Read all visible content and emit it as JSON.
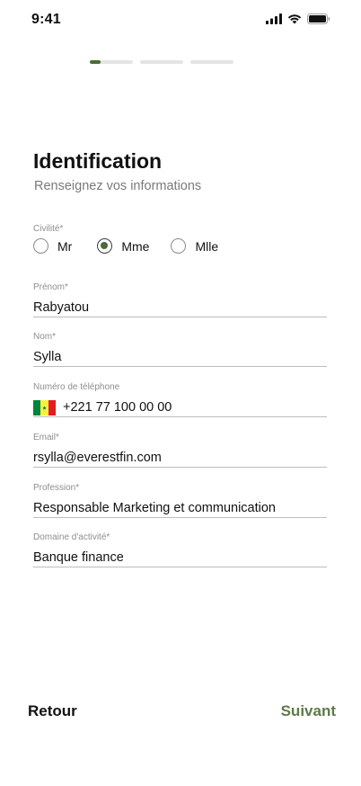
{
  "status_bar": {
    "time": "9:41"
  },
  "progress": {
    "steps": 3,
    "current": 1,
    "first_fill": 0.25
  },
  "header": {
    "title": "Identification",
    "subtitle": "Renseignez vos informations"
  },
  "civility": {
    "label": "Civilité*",
    "options": [
      "Mr",
      "Mme",
      "Mlle"
    ],
    "selected": "Mme"
  },
  "fields": {
    "first_name": {
      "label": "Prénom*",
      "value": "Rabyatou"
    },
    "last_name": {
      "label": "Nom*",
      "value": "Sylla"
    },
    "phone": {
      "label": "Numéro de téléphone",
      "value": "+221 77 100 00 00",
      "flag": "senegal-flag-icon"
    },
    "email": {
      "label": "Email*",
      "value": "rsylla@everestfin.com"
    },
    "profession": {
      "label": "Profession*",
      "value": "Responsable Marketing et communication"
    },
    "domain": {
      "label": "Domaine d'activité*",
      "value": "Banque finance"
    }
  },
  "footer": {
    "back_label": "Retour",
    "next_label": "Suivant"
  },
  "colors": {
    "accent": "#4a6b3a",
    "next": "#5d7a47",
    "muted": "#7a7a7a",
    "divider": "#bdbdbd"
  }
}
